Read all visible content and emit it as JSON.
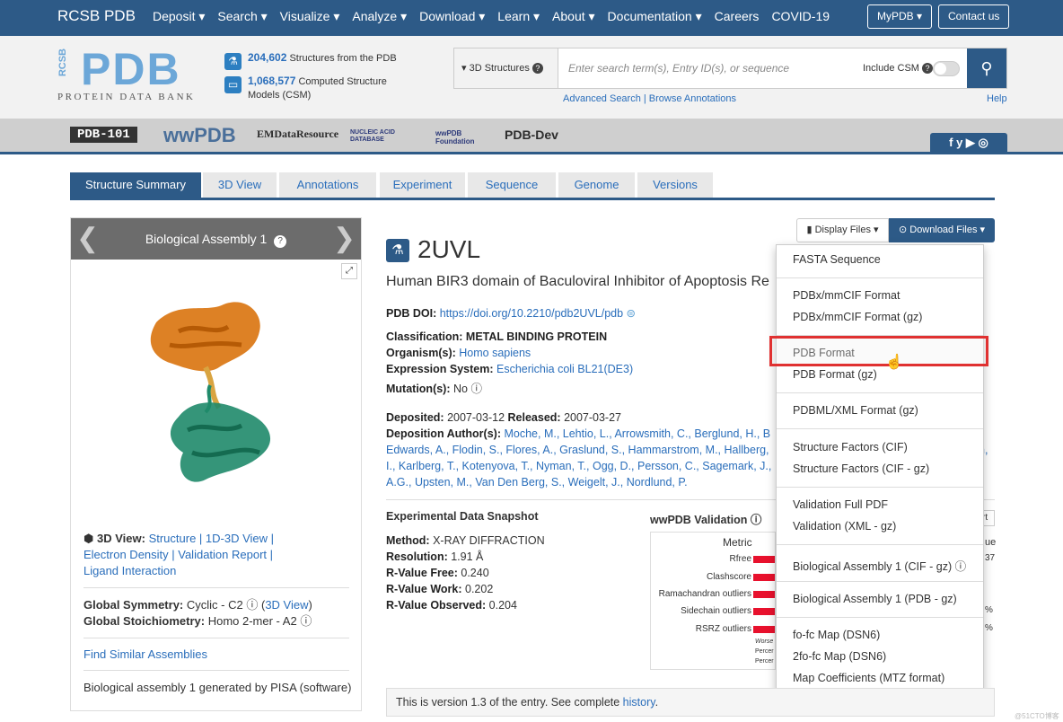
{
  "topnav": {
    "brand": "RCSB PDB",
    "menu": [
      "Deposit ▾",
      "Search ▾",
      "Visualize ▾",
      "Analyze ▾",
      "Download ▾",
      "Learn ▾",
      "About ▾",
      "Documentation ▾",
      "Careers",
      "COVID-19"
    ],
    "mypdb": "MyPDB ▾",
    "contact": "Contact us"
  },
  "header": {
    "logo": "PDB",
    "logo_side": "RCSB",
    "logo_sub": "PROTEIN DATA BANK",
    "stat1_num": "204,602",
    "stat1_text": "Structures from the PDB",
    "stat2_num": "1,068,577",
    "stat2_text": "Computed Structure",
    "stat2_text2": "Models (CSM)"
  },
  "search": {
    "dropdown": "▾ 3D Structures",
    "placeholder": "Enter search term(s), Entry ID(s), or sequence",
    "csm": "Include CSM",
    "advanced": "Advanced Search | Browse Annotations",
    "help": "Help"
  },
  "partners": [
    "PDB-101",
    "wwPDB",
    "EMDataResource",
    "NUCLEIC ACID DATABASE",
    "wwPDB Foundation",
    "PDB-Dev"
  ],
  "tabs": [
    "Structure Summary",
    "3D View",
    "Annotations",
    "Experiment",
    "Sequence",
    "Genome",
    "Versions"
  ],
  "left": {
    "header": "Biological Assembly 1",
    "view3d_label": "3D View:",
    "view3d_links": "Structure | 1D-3D View |",
    "links2": "Electron Density | Validation Report |",
    "links3": "Ligand Interaction",
    "sym_label": "Global Symmetry:",
    "sym_value": "Cyclic - C2",
    "sym_link": "3D View",
    "stoich_label": "Global Stoichiometry:",
    "stoich_value": "Homo 2-mer - A2",
    "similar": "Find Similar Assemblies",
    "generated": "Biological assembly 1 generated by PISA (software)"
  },
  "entry": {
    "id": "2UVL",
    "title": "Human BIR3 domain of Baculoviral Inhibitor of Apoptosis Re",
    "doi_label": "PDB DOI:",
    "doi": "https://doi.org/10.2210/pdb2UVL/pdb",
    "class_label": "Classification:",
    "class": "METAL BINDING PROTEIN",
    "org_label": "Organism(s):",
    "org": "Homo sapiens",
    "expr_label": "Expression System:",
    "expr": "Escherichia coli BL21(DE3)",
    "mut_label": "Mutation(s):",
    "mut": "No",
    "dep_label": "Deposited:",
    "dep": "2007-03-12",
    "rel_label": "Released:",
    "rel": "2007-03-27",
    "auth_label": "Deposition Author(s):",
    "auth1": "Moche, M., Lehtio, L., Arrowsmith, C., Berglund, H., B",
    "auth2": "Edwards, A., Flodin, S., Flores, A., Graslund, S., Hammarstrom, M., Hallberg,",
    "auth3": "I., Karlberg, T., Kotenyova, T., Nyman, T., Ogg, D., Persson, C., Sagemark, J.,",
    "auth4": "A.G., Upsten, M., Van Den Berg, S., Weigelt, J., Nordlund, P.",
    "auth_tail": "n,"
  },
  "snapshot": {
    "title": "Experimental Data Snapshot",
    "method_label": "Method:",
    "method": "X-RAY DIFFRACTION",
    "res_label": "Resolution:",
    "res": "1.91 Å",
    "rfree_label": "R-Value Free:",
    "rfree": "0.240",
    "rwork_label": "R-Value Work:",
    "rwork": "0.202",
    "robs_label": "R-Value Observed:",
    "robs": "0.204"
  },
  "validation": {
    "title": "wwPDB Validation",
    "metric": "Metric",
    "rows": [
      "Rfree",
      "Clashscore",
      "Ramachandran outliers",
      "Sidechain outliers",
      "RSRZ outliers"
    ],
    "worse": "Worse",
    "percentile": "Percer",
    "percentile2": "Percer"
  },
  "buttons": {
    "display": "Display Files ▾",
    "download": "Download Files ▾"
  },
  "download_menu": [
    "FASTA Sequence",
    "PDBx/mmCIF Format",
    "PDBx/mmCIF Format (gz)",
    "PDB Format",
    "PDB Format (gz)",
    "PDBML/XML Format (gz)",
    "Structure Factors (CIF)",
    "Structure Factors (CIF - gz)",
    "Validation Full PDF",
    "Validation (XML - gz)",
    "Biological Assembly 1 (CIF - gz)",
    "Biological Assembly 1 (PDB - gz)",
    "fo-fc Map (DSN6)",
    "2fo-fc Map (DSN6)",
    "Map Coefficients (MTZ format)"
  ],
  "footer": {
    "text": "This is version 1.3 of the entry. See complete ",
    "link": "history",
    "dot": "."
  },
  "watermark": "@51CTO博客"
}
